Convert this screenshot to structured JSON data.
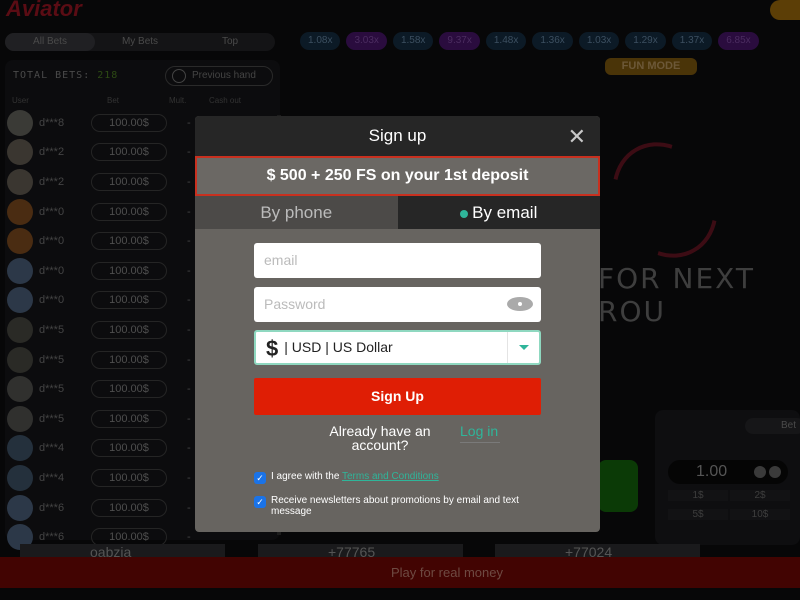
{
  "header": {
    "logo": "Aviator"
  },
  "bets_tabs": [
    "All Bets",
    "My Bets",
    "Top"
  ],
  "multipliers": [
    {
      "v": "1.08x",
      "c": "b"
    },
    {
      "v": "3.03x",
      "c": "p"
    },
    {
      "v": "1.58x",
      "c": "b"
    },
    {
      "v": "9.37x",
      "c": "p"
    },
    {
      "v": "1.48x",
      "c": "b"
    },
    {
      "v": "1.36x",
      "c": "b"
    },
    {
      "v": "1.03x",
      "c": "b"
    },
    {
      "v": "1.29x",
      "c": "b"
    },
    {
      "v": "1.37x",
      "c": "b"
    },
    {
      "v": "6.85x",
      "c": "p"
    }
  ],
  "fun_mode": "FUN MODE",
  "bets": {
    "total_label": "TOTAL BETS:",
    "total": "218",
    "previous_hand": "Previous hand",
    "columns": [
      "User",
      "Bet",
      "Mult.",
      "Cash out"
    ],
    "rows": [
      [
        "d***8",
        "100.00$",
        "-"
      ],
      [
        "d***2",
        "100.00$",
        "-"
      ],
      [
        "d***2",
        "100.00$",
        "-"
      ],
      [
        "d***0",
        "100.00$",
        "-"
      ],
      [
        "d***0",
        "100.00$",
        "-"
      ],
      [
        "d***0",
        "100.00$",
        "-"
      ],
      [
        "d***0",
        "100.00$",
        "-"
      ],
      [
        "d***5",
        "100.00$",
        "-"
      ],
      [
        "d***5",
        "100.00$",
        "-"
      ],
      [
        "d***5",
        "100.00$",
        "-"
      ],
      [
        "d***5",
        "100.00$",
        "-"
      ],
      [
        "d***4",
        "100.00$",
        "-"
      ],
      [
        "d***4",
        "100.00$",
        "-"
      ],
      [
        "d***6",
        "100.00$",
        "-"
      ],
      [
        "d***6",
        "100.00$",
        "-"
      ]
    ]
  },
  "game": {
    "waiting": "FOR NEXT ROU"
  },
  "betpanel": {
    "tab": "Bet",
    "amount": "1.00",
    "quick": [
      "1$",
      "2$",
      "5$",
      "10$"
    ]
  },
  "winners": [
    "oabzia",
    "+77765",
    "+77024"
  ],
  "cta": "Play for real money",
  "modal": {
    "title": "Sign up",
    "promo": "$ 500 + 250 FS on your 1st deposit",
    "tab_phone": "By phone",
    "tab_email": "By email",
    "email_placeholder": "email",
    "password_placeholder": "Password",
    "currency_symbol": "$",
    "currency": "| USD | US Dollar",
    "signup": "Sign Up",
    "already": "Already have an account?",
    "login": "Log in",
    "agree_prefix": "I agree with the ",
    "terms": "Terms and Conditions",
    "newsletter": "Receive newsletters about promotions by email and text message"
  }
}
